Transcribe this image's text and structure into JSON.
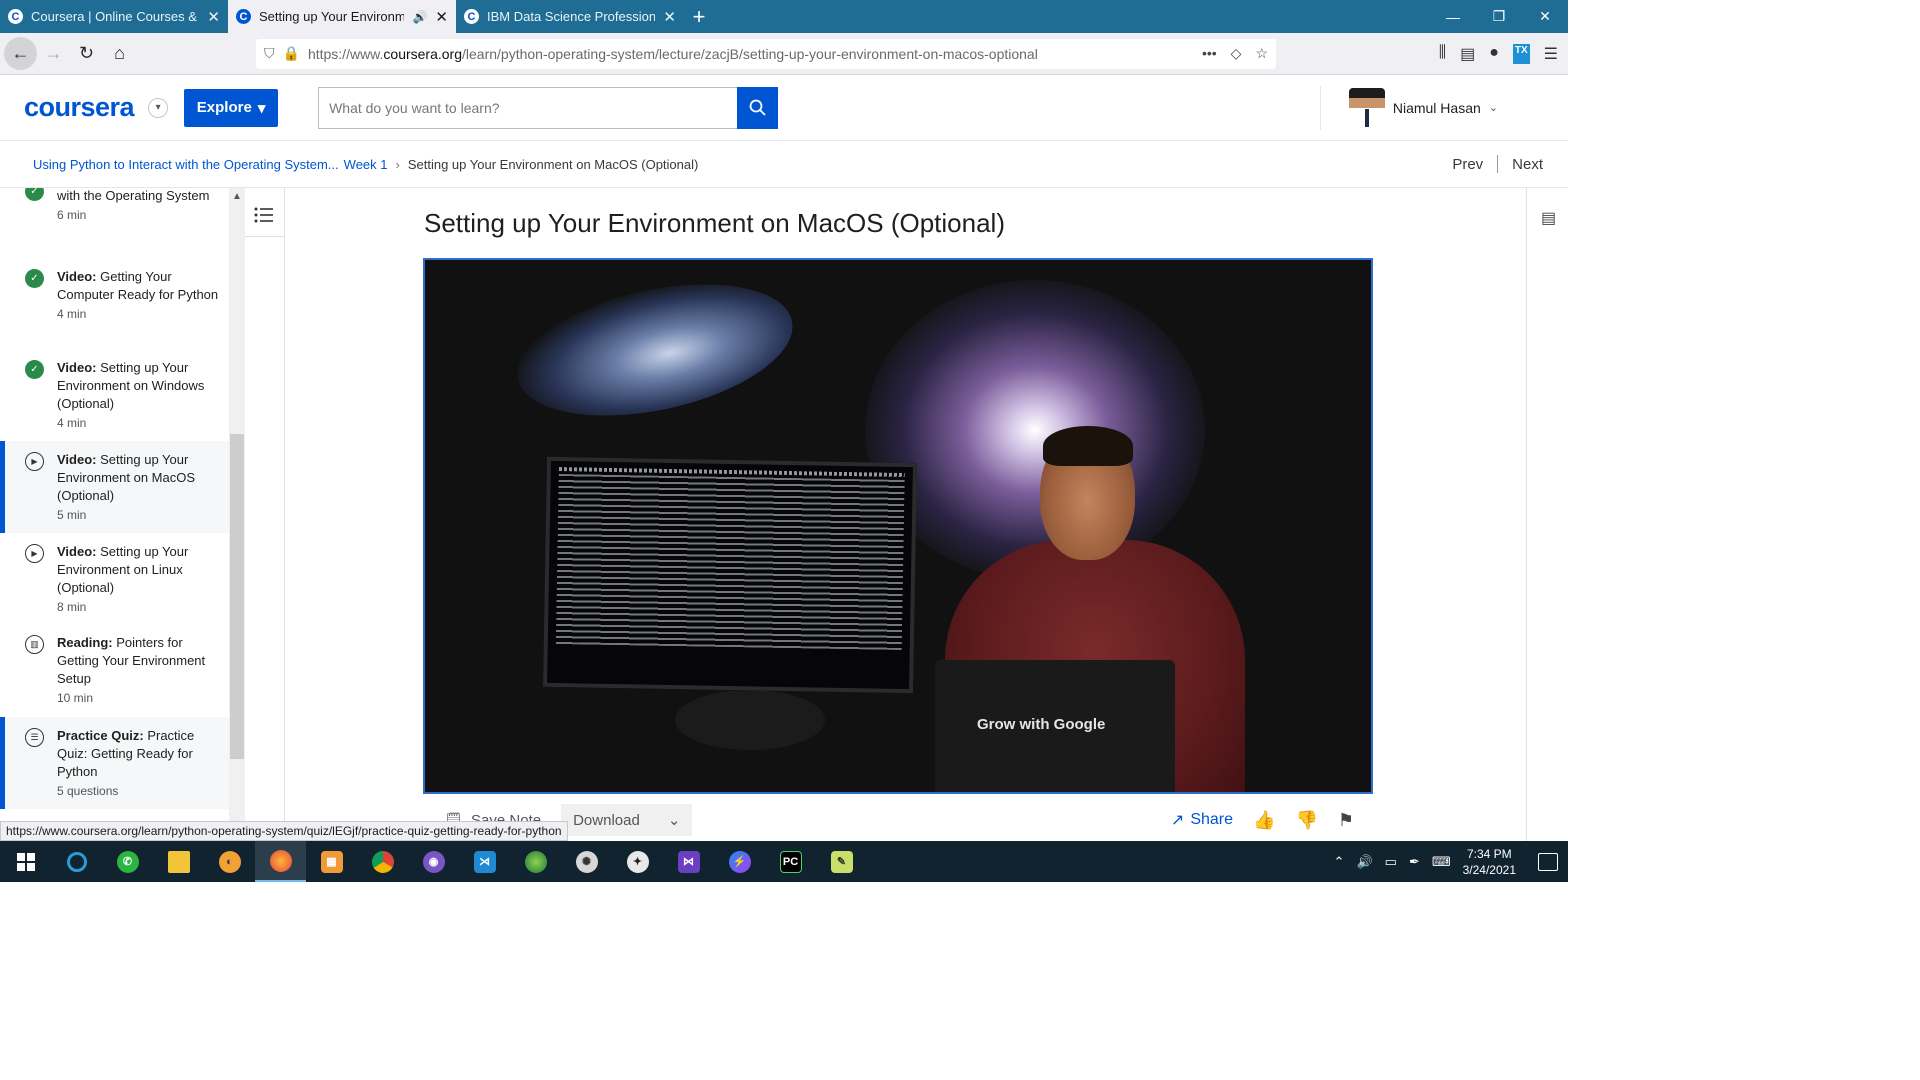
{
  "browser": {
    "tabs": [
      {
        "title": "Coursera | Online Courses & Cr",
        "active": false,
        "audio": false
      },
      {
        "title": "Setting up Your Environmen",
        "active": true,
        "audio": true
      },
      {
        "title": "IBM Data Science Professional",
        "active": false,
        "audio": false
      }
    ],
    "url_prefix": "https://www.",
    "url_domain": "coursera.org",
    "url_path": "/learn/python-operating-system/lecture/zacjB/setting-up-your-environment-on-macos-optional"
  },
  "header": {
    "logo": "coursera",
    "explore_label": "Explore",
    "search_placeholder": "What do you want to learn?",
    "user_name": "Niamul Hasan"
  },
  "breadcrumb": {
    "course": "Using Python to Interact with the Operating System...",
    "week": "Week 1",
    "current": "Setting up Your Environment on MacOS (Optional)",
    "prev": "Prev",
    "next": "Next"
  },
  "sidebar": {
    "items": [
      {
        "type": "done",
        "kind": "",
        "title": "with the Operating System",
        "duration": "6 min"
      },
      {
        "type": "done",
        "kind": "Video:",
        "title": "Getting Your Computer Ready for Python",
        "duration": "4 min"
      },
      {
        "type": "done",
        "kind": "Video:",
        "title": "Setting up Your Environment on Windows (Optional)",
        "duration": "4 min"
      },
      {
        "type": "play",
        "kind": "Video:",
        "title": "Setting up Your Environment on MacOS (Optional)",
        "duration": "5 min"
      },
      {
        "type": "play",
        "kind": "Video:",
        "title": "Setting up Your Environment on Linux (Optional)",
        "duration": "8 min"
      },
      {
        "type": "read",
        "kind": "Reading:",
        "title": "Pointers for Getting Your Environment Setup",
        "duration": "10 min"
      },
      {
        "type": "quiz",
        "kind": "Practice Quiz:",
        "title": "Practice Quiz: Getting Ready for Python",
        "duration": "5 questions"
      }
    ]
  },
  "main": {
    "title": "Setting up Your Environment on MacOS (Optional)",
    "laptop_text": "Grow with Google",
    "save_note": "Save Note",
    "download": "Download",
    "share": "Share"
  },
  "status_url": "https://www.coursera.org/learn/python-operating-system/quiz/lEGjf/practice-quiz-getting-ready-for-python",
  "taskbar": {
    "time": "7:34 PM",
    "date": "3/24/2021"
  },
  "colors": {
    "brand": "#0056d2",
    "tabbar": "#1f6d94",
    "done": "#2a8a4a"
  }
}
